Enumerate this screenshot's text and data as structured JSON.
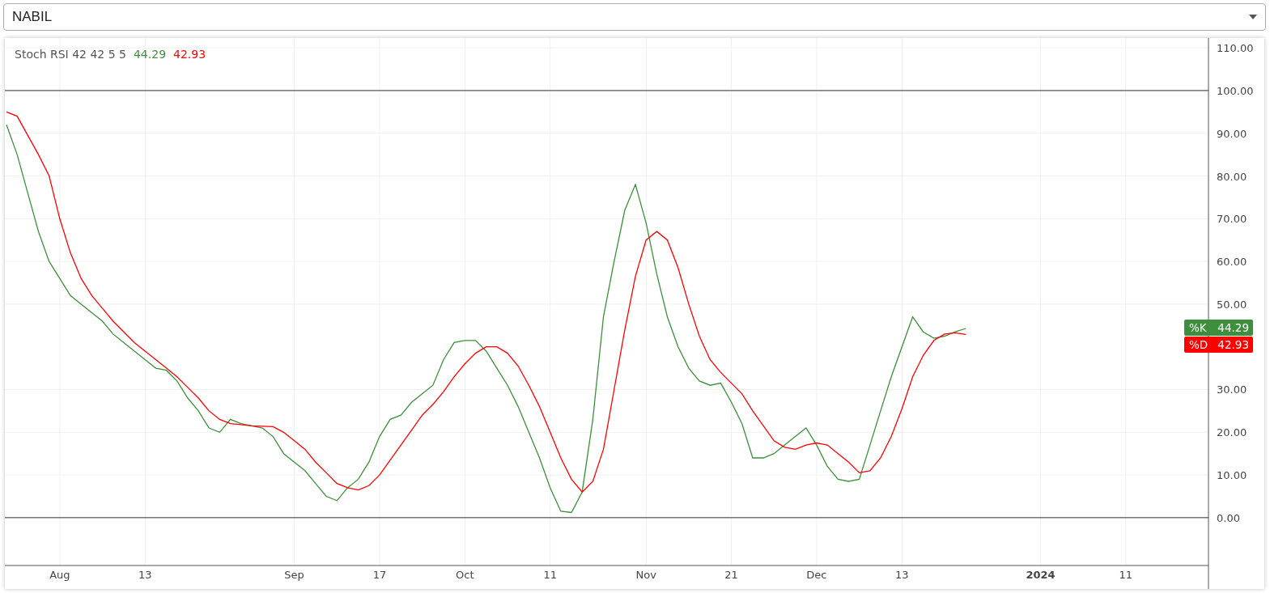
{
  "symbol_select": {
    "value": "NABIL"
  },
  "chart": {
    "legend": {
      "text": "Stoch RSI 42 42 5 5",
      "values": [
        "44.29",
        "42.93"
      ]
    },
    "value_badges": [
      {
        "value": "44.29"
      },
      {
        "value": "42.93"
      }
    ],
    "chart_data": {
      "type": "line",
      "categories": [
        null,
        null,
        null,
        null,
        null,
        "Aug",
        null,
        null,
        null,
        null,
        null,
        null,
        null,
        "13",
        null,
        null,
        null,
        null,
        null,
        null,
        null,
        null,
        null,
        null,
        null,
        null,
        null,
        "Sep",
        null,
        null,
        null,
        null,
        null,
        null,
        null,
        "17",
        null,
        null,
        null,
        null,
        null,
        null,
        null,
        "Oct",
        null,
        null,
        null,
        null,
        null,
        null,
        null,
        "11",
        null,
        null,
        null,
        null,
        null,
        null,
        null,
        null,
        "Nov",
        null,
        null,
        null,
        null,
        null,
        null,
        null,
        "21",
        null,
        null,
        null,
        null,
        null,
        null,
        null,
        "Dec",
        null,
        null,
        null,
        null,
        null,
        null,
        null,
        "13",
        null,
        null,
        null,
        null,
        null,
        null,
        null,
        null,
        null,
        null,
        null,
        null,
        "**2024**",
        null,
        null,
        null,
        null,
        null,
        null,
        null,
        "11",
        null,
        null,
        null,
        null,
        null,
        null,
        null,
        null
      ],
      "series": [
        {
          "name": "%K",
          "color": "#3d8f3d",
          "values": [
            92,
            85,
            76,
            67,
            60,
            56,
            52,
            50,
            48,
            46,
            43,
            41,
            39,
            37,
            35,
            34.5,
            32,
            28,
            25,
            21,
            20,
            23,
            22,
            21.5,
            21,
            19,
            15,
            13,
            11,
            8,
            5,
            4,
            7,
            9,
            13,
            19,
            23,
            24,
            27,
            29,
            31,
            37,
            41,
            41.5,
            41.5,
            39,
            35,
            31,
            26,
            20,
            14,
            7,
            1.5,
            1.2,
            6,
            23,
            47,
            60,
            72,
            78,
            69,
            57,
            47,
            40,
            35,
            32,
            31,
            31.5,
            27,
            22,
            14,
            14,
            15,
            17,
            19,
            21,
            17,
            12,
            9,
            8.5,
            9,
            17,
            25,
            33,
            40,
            47,
            43.5,
            42,
            42.5,
            43.5,
            44.3,
            null,
            null,
            null,
            null,
            null,
            null,
            null,
            null,
            null,
            null,
            null,
            null,
            null,
            null,
            null,
            null,
            null,
            null,
            null,
            null,
            null,
            null,
            null
          ]
        },
        {
          "name": "%D",
          "color": "#ff0000",
          "values": [
            95,
            94,
            89.5,
            85,
            80,
            70,
            62,
            56,
            52,
            49,
            46,
            43.5,
            41,
            39,
            37,
            35,
            33,
            30.5,
            28,
            25,
            23,
            22,
            21.8,
            21.5,
            21.4,
            21.3,
            20,
            18,
            16,
            13,
            10.5,
            8,
            7,
            6.5,
            7.5,
            10,
            13.5,
            17,
            20.5,
            24,
            26.5,
            29.5,
            33,
            36,
            38.5,
            40,
            40,
            38.5,
            35.5,
            31,
            26,
            20,
            14,
            9,
            6,
            8.5,
            16,
            30,
            44,
            56.5,
            65,
            67,
            65,
            58.5,
            50,
            42.5,
            37,
            34,
            31.5,
            29,
            25,
            21.5,
            18,
            16.5,
            16,
            17,
            17.5,
            17,
            15,
            13,
            10.5,
            11,
            14,
            19,
            25.5,
            33,
            38,
            41.5,
            43,
            43.3,
            42.9,
            null,
            null,
            null,
            null,
            null,
            null,
            null,
            null,
            null,
            null,
            null,
            null,
            null,
            null,
            null,
            null,
            null,
            null,
            null,
            null,
            null,
            null,
            null
          ]
        }
      ],
      "ylim": [
        -11.2,
        112.3
      ],
      "yticks": [
        {
          "value": 0,
          "label": "0.00"
        },
        {
          "value": 10,
          "label": "10.00"
        },
        {
          "value": 20,
          "label": "20.00"
        },
        {
          "value": 30,
          "label": "30.00"
        },
        {
          "value": 50,
          "label": "50.00"
        },
        {
          "value": 60,
          "label": "60.00"
        },
        {
          "value": 70,
          "label": "70.00"
        },
        {
          "value": 80,
          "label": "80.00"
        },
        {
          "value": 90,
          "label": "90.00"
        },
        {
          "value": 100,
          "label": "100.00"
        },
        {
          "value": 110,
          "label": "110.00"
        }
      ],
      "grid": true
    }
  }
}
